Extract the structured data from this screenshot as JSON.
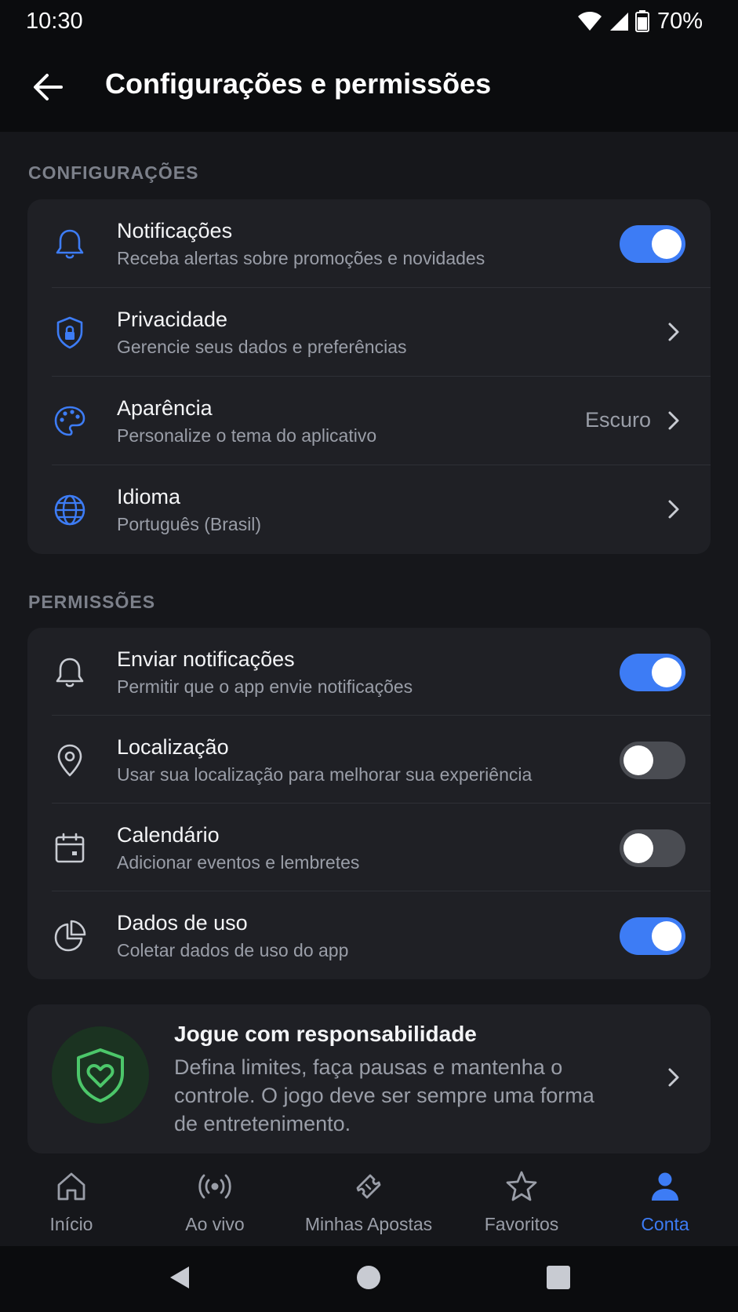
{
  "status_bar": {
    "time": "10:30",
    "battery": "70%"
  },
  "app_bar": {
    "title": "Configurações e permissões"
  },
  "sections": {
    "settings": {
      "label": "CONFIGURAÇÕES",
      "items": [
        {
          "title": "Notificações",
          "subtitle": "Receba alertas sobre promoções e novidades",
          "control": "toggle",
          "on": true
        },
        {
          "title": "Privacidade",
          "subtitle": "Gerencie seus dados e preferências",
          "control": "chevron"
        },
        {
          "title": "Aparência",
          "subtitle": "Personalize o tema do aplicativo",
          "value": "Escuro",
          "control": "chevron"
        },
        {
          "title": "Idioma",
          "subtitle": "Português (Brasil)",
          "control": "chevron"
        }
      ]
    },
    "permissions": {
      "label": "PERMISSÕES",
      "items": [
        {
          "title": "Enviar notificações",
          "subtitle": "Permitir que o app envie notificações",
          "control": "toggle",
          "on": true
        },
        {
          "title": "Localização",
          "subtitle": "Usar sua localização para melhorar sua experiência",
          "control": "toggle",
          "on": false
        },
        {
          "title": "Calendário",
          "subtitle": "Adicionar eventos e lembretes",
          "control": "toggle",
          "on": false
        },
        {
          "title": "Dados de uso",
          "subtitle": "Coletar dados de uso do app",
          "control": "toggle",
          "on": true
        }
      ]
    }
  },
  "promo": {
    "title": "Jogue com responsabilidade",
    "description": "Defina limites, faça pausas e mantenha o controle. O jogo deve ser sempre uma forma de entretenimento."
  },
  "bottom_nav": [
    {
      "label": "Início",
      "icon": "home-icon",
      "active": false
    },
    {
      "label": "Ao vivo",
      "icon": "live-icon",
      "active": false
    },
    {
      "label": "Minhas Apostas",
      "icon": "ticket-icon",
      "active": false
    },
    {
      "label": "Favoritos",
      "icon": "star-icon",
      "active": false
    },
    {
      "label": "Conta",
      "icon": "user-icon",
      "active": true
    }
  ],
  "colors": {
    "accent": "#3d7cf5",
    "background": "#16171b",
    "card": "#1f2025",
    "promo_green": "#4cc76a"
  }
}
